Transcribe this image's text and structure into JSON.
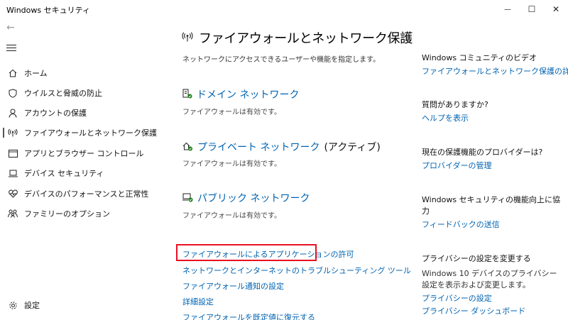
{
  "window": {
    "title": "Windows セキュリティ",
    "minimize": "—",
    "maximize": "☐",
    "close": "✕"
  },
  "sidebar": {
    "back_glyph": "←",
    "items": [
      {
        "label": "ホーム",
        "icon": "home-icon"
      },
      {
        "label": "ウイルスと脅威の防止",
        "icon": "shield-icon"
      },
      {
        "label": "アカウントの保護",
        "icon": "person-icon"
      },
      {
        "label": "ファイアウォールとネットワーク保護",
        "icon": "wireless-icon"
      },
      {
        "label": "アプリとブラウザー コントロール",
        "icon": "browser-window-icon"
      },
      {
        "label": "デバイス セキュリティ",
        "icon": "laptop-icon"
      },
      {
        "label": "デバイスのパフォーマンスと正常性",
        "icon": "heart-pulse-icon"
      },
      {
        "label": "ファミリーのオプション",
        "icon": "family-icon"
      }
    ],
    "settings_label": "設定"
  },
  "main": {
    "title": "ファイアウォールとネットワーク保護",
    "subtitle": "ネットワークにアクセスできるユーザーや機能を指定します。",
    "networks": [
      {
        "name": "ドメイン ネットワーク",
        "suffix": "",
        "status": "ファイアウォールは有効です。",
        "icon": "domain-network-icon"
      },
      {
        "name": "プライベート ネットワーク",
        "suffix": "(アクティブ)",
        "status": "ファイアウォールは有効です。",
        "icon": "private-network-icon"
      },
      {
        "name": "パブリック ネットワーク",
        "suffix": "",
        "status": "ファイアウォールは有効です。",
        "icon": "public-network-icon"
      }
    ],
    "links": [
      "ファイアウォールによるアプリケーションの許可",
      "ネットワークとインターネットのトラブルシューティング ツール",
      "ファイアウォール通知の設定",
      "詳細設定",
      "ファイアウォールを既定値に復元する"
    ]
  },
  "right": {
    "community": {
      "head": "Windows コミュニティのビデオ",
      "link": "ファイアウォールとネットワーク保護の詳細"
    },
    "question": {
      "head": "質問がありますか?",
      "link": "ヘルプを表示"
    },
    "provider": {
      "head": "現在の保護機能のプロバイダーは?",
      "link": "プロバイダーの管理"
    },
    "improve": {
      "head": "Windows セキュリティの機能向上に協力",
      "link": "フィードバックの送信"
    },
    "privacy": {
      "head": "プライバシーの設定を変更する",
      "body": "Windows 10 デバイスのプライバシー設定を表示および変更します。",
      "link1": "プライバシーの設定",
      "link2": "プライバシー ダッシュボード"
    }
  },
  "colors": {
    "accent": "#0063b1",
    "highlight": "#e81123",
    "ok": "#107c10"
  }
}
